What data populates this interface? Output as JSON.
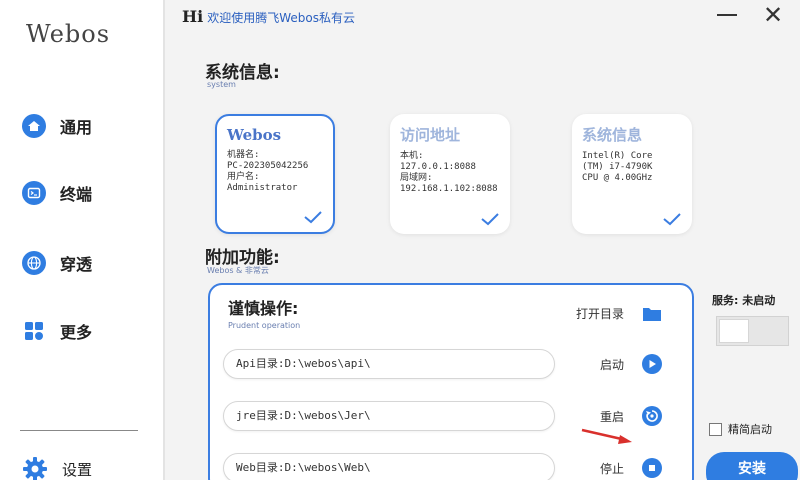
{
  "app": {
    "logo": "Webos"
  },
  "header": {
    "hi": "Hi",
    "message": "欢迎使用腾飞Webos私有云",
    "minimize_icon": "minimize-icon",
    "close_icon": "close-icon",
    "close_glyph": "✕"
  },
  "sidebar": {
    "items": [
      {
        "label": "通用",
        "icon": "home-icon"
      },
      {
        "label": "终端",
        "icon": "terminal-icon"
      },
      {
        "label": "穿透",
        "icon": "globe-icon"
      },
      {
        "label": "更多",
        "icon": "grid-icon"
      }
    ],
    "settings": {
      "label": "设置",
      "icon": "gear-icon"
    }
  },
  "system_info": {
    "title": "系统信息:",
    "subtitle": "system",
    "cards": [
      {
        "title": "Webos",
        "lines": [
          "机器名:",
          "PC-202305042256",
          "用户名:",
          "Administrator"
        ],
        "active": true
      },
      {
        "title": "访问地址",
        "lines": [
          "本机:",
          "127.0.0.1:8088",
          "局域网:",
          "192.168.1.102:8088"
        ],
        "active": false
      },
      {
        "title": "系统信息",
        "lines": [
          "Intel(R) Core",
          "(TM) i7-4790K",
          "CPU @ 4.00GHz"
        ],
        "active": false
      }
    ]
  },
  "extra": {
    "title": "附加功能:",
    "subtitle": "Webos & 非常云",
    "panel": {
      "title": "谨慎操作:",
      "subtitle": "Prudent operation",
      "open_dir_label": "打开目录",
      "open_dir_icon": "folder-icon",
      "paths": [
        "Api目录:D:\\webos\\api\\",
        "jre目录:D:\\webos\\Jer\\",
        "Web目录:D:\\webos\\Web\\"
      ],
      "actions": [
        {
          "label": "启动",
          "icon": "play-icon"
        },
        {
          "label": "重启",
          "icon": "restart-icon"
        },
        {
          "label": "停止",
          "icon": "stop-icon"
        }
      ]
    }
  },
  "service": {
    "status": "服务: 未启动",
    "toggle_on": false,
    "simple_start_label": "精简启动",
    "simple_start_checked": false,
    "install_label": "安装"
  },
  "colors": {
    "accent": "#2f7de1",
    "annotation": "#d9302c"
  }
}
